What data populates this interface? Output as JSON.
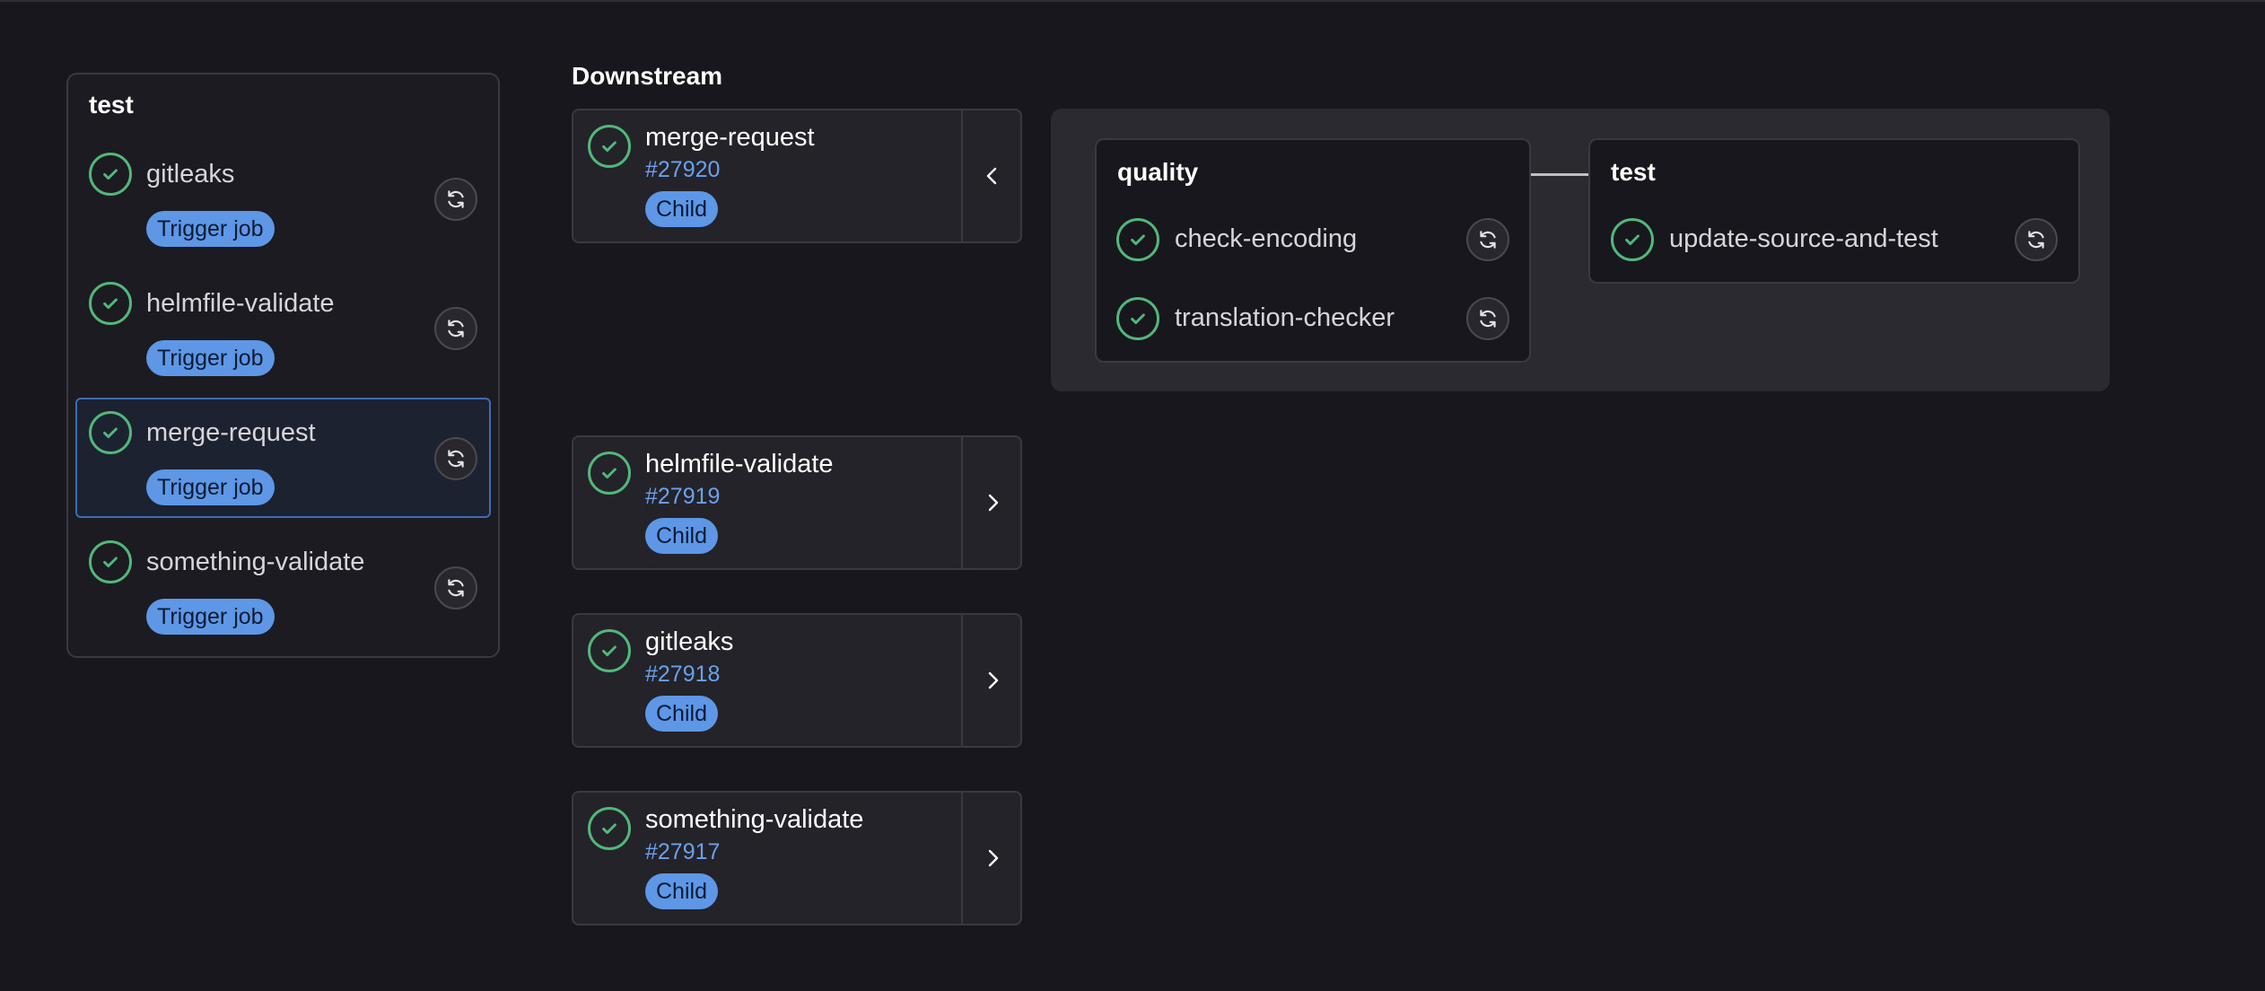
{
  "left_stage": {
    "title": "test",
    "jobs": [
      {
        "name": "gitleaks",
        "badge": "Trigger job"
      },
      {
        "name": "helmfile-validate",
        "badge": "Trigger job"
      },
      {
        "name": "merge-request",
        "badge": "Trigger job",
        "selected": true
      },
      {
        "name": "something-validate",
        "badge": "Trigger job"
      }
    ]
  },
  "downstream": {
    "heading": "Downstream",
    "pipelines": [
      {
        "name": "merge-request",
        "id": "#27920",
        "badge": "Child",
        "expanded": true
      },
      {
        "name": "helmfile-validate",
        "id": "#27919",
        "badge": "Child",
        "expanded": false
      },
      {
        "name": "gitleaks",
        "id": "#27918",
        "badge": "Child",
        "expanded": false
      },
      {
        "name": "something-validate",
        "id": "#27917",
        "badge": "Child",
        "expanded": false
      }
    ]
  },
  "child_pipeline": {
    "stages": [
      {
        "title": "quality",
        "jobs": [
          {
            "name": "check-encoding"
          },
          {
            "name": "translation-checker"
          }
        ]
      },
      {
        "title": "test",
        "jobs": [
          {
            "name": "update-source-and-test"
          }
        ]
      }
    ]
  },
  "icons": {
    "status": "status-success-icon",
    "retry": "retry-icon",
    "collapse": "chevron-left-icon",
    "expand": "chevron-right-icon"
  },
  "colors": {
    "background": "#18171d",
    "success": "#52b87a",
    "badge": "#5d97e6",
    "link": "#6aa1ec",
    "selected_border": "#3f6bb2"
  }
}
